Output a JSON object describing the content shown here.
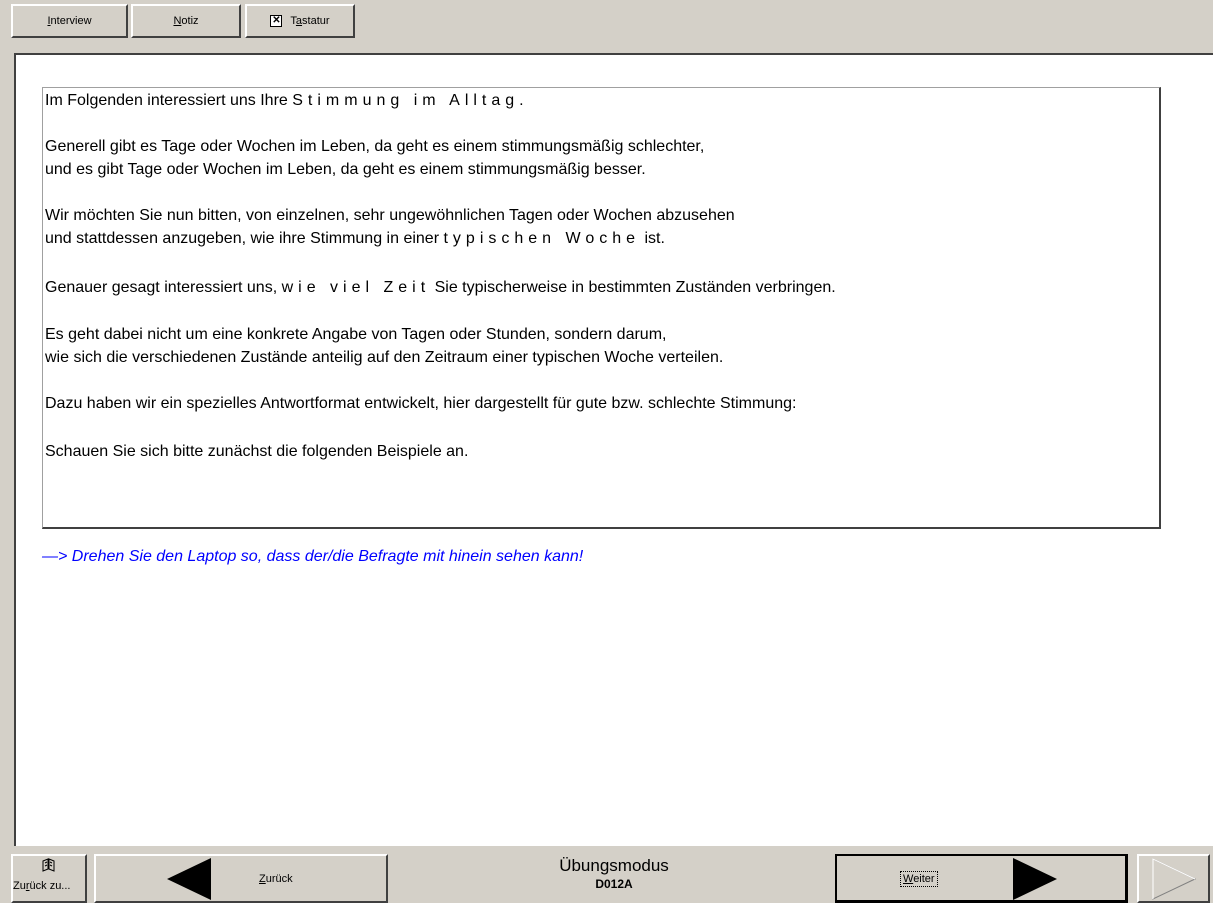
{
  "toolbar": {
    "interview": {
      "pre": "",
      "key": "I",
      "post": "nterview"
    },
    "notiz": {
      "pre": "",
      "key": "N",
      "post": "otiz"
    },
    "tastatur": {
      "pre": "T",
      "key": "a",
      "post": "statur",
      "checked": true
    }
  },
  "question": {
    "line1": {
      "pre": "Im Folgenden interessiert uns Ihre ",
      "emph": "Stimmung im Alltag",
      "post": "."
    },
    "line2": "Generell gibt es Tage oder Wochen im Leben, da geht es einem stimmungsmäßig schlechter,",
    "line3": "und es gibt Tage oder Wochen im Leben, da geht es einem stimmungsmäßig besser.",
    "line4": "Wir möchten Sie nun bitten, von einzelnen, sehr ungewöhnlichen Tagen oder Wochen abzusehen",
    "line5": {
      "pre": "und stattdessen anzugeben, wie ihre Stimmung in einer ",
      "emph": "typischen Woche",
      "post": " ist."
    },
    "line6": {
      "pre": "Genauer gesagt interessiert uns, ",
      "emph": "wie viel Zeit",
      "post": " Sie typischerweise in bestimmten Zuständen verbringen."
    },
    "line7": "Es geht dabei nicht um eine konkrete Angabe von Tagen oder Stunden, sondern darum,",
    "line8": "wie sich die verschiedenen Zustände anteilig auf den Zeitraum einer typischen Woche verteilen.",
    "line9": "Dazu haben wir ein spezielles Antwortformat entwickelt, hier dargestellt für gute bzw. schlechte Stimmung:",
    "line10": "Schauen Sie sich bitte zunächst die folgenden Beispiele an."
  },
  "instruction": "—>  Drehen Sie den Laptop so, dass der/die Befragte mit hinein sehen kann!",
  "bottom": {
    "jump_back": {
      "pre": "Zu",
      "key": "r",
      "post": "ück zu..."
    },
    "back": {
      "key": "Z",
      "post": "urück"
    },
    "mode": "Übungsmodus",
    "code": "D012A",
    "next": {
      "key": "W",
      "post": "eiter"
    }
  },
  "icons": {
    "jump_back": "book-icon",
    "back": "arrow-left-icon",
    "next": "arrow-right-icon",
    "end": "arrow-right-outline-icon"
  }
}
